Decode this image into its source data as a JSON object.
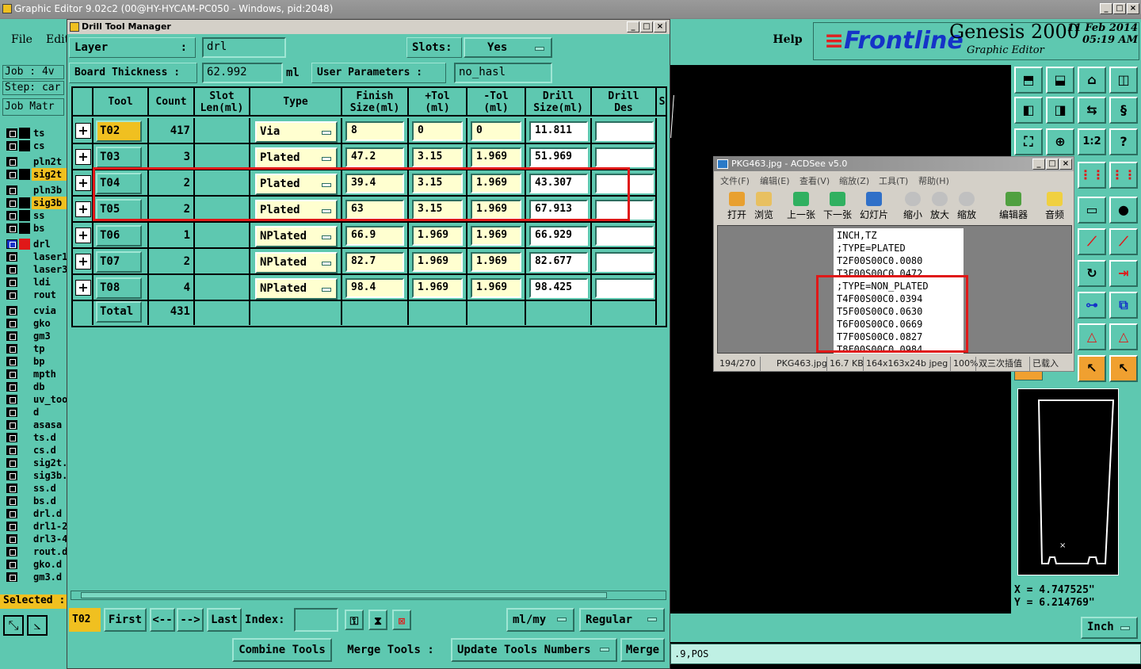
{
  "outer": {
    "title": "Graphic Editor 9.02c2 (00@HY-HYCAM-PC050 - Windows, pid:2048)"
  },
  "ge": {
    "menu": [
      "File",
      "Edit"
    ],
    "help": "Help",
    "logo_brand": "Frontline",
    "logo_product": "Genesis 2000",
    "logo_sub": "Graphic Editor",
    "date": "11 Feb 2014",
    "time": "05:19 AM",
    "job": "Job  : 4v",
    "step": "Step: car",
    "job_matrix": "Job Matr",
    "selected": "Selected :",
    "coords_x": "X  = 4.747525\"",
    "coords_y": "Y  = 6.214769\"",
    "units": "Inch",
    "cmdline": ".9,POS"
  },
  "layers": [
    {
      "name": "ts",
      "color": "#5ec8b0",
      "swatch": "#000000"
    },
    {
      "name": "cs",
      "color": "#5ec8b0",
      "swatch": "#000000"
    },
    {
      "name": "pln2t",
      "color": "#5ec8b0",
      "swatch": ""
    },
    {
      "name": "sig2t",
      "color": "#f0c020",
      "swatch": "#000000"
    },
    {
      "name": "pln3b",
      "color": "#5ec8b0",
      "swatch": ""
    },
    {
      "name": "sig3b",
      "color": "#f0c020",
      "swatch": "#000000"
    },
    {
      "name": "ss",
      "color": "#5ec8b0",
      "swatch": "#000000"
    },
    {
      "name": "bs",
      "color": "#5ec8b0",
      "swatch": "#000000"
    },
    {
      "name": "drl",
      "color": "#5ec8b0",
      "swatch": "#e01818"
    },
    {
      "name": "laser1",
      "color": "#5ec8b0",
      "swatch": ""
    },
    {
      "name": "laser3",
      "color": "#5ec8b0",
      "swatch": ""
    },
    {
      "name": "ldi",
      "color": "#5ec8b0",
      "swatch": ""
    },
    {
      "name": "rout",
      "color": "#5ec8b0",
      "swatch": ""
    },
    {
      "name": "cvia",
      "color": "#5ec8b0",
      "swatch": ""
    },
    {
      "name": "gko",
      "color": "#5ec8b0",
      "swatch": ""
    },
    {
      "name": "gm3",
      "color": "#5ec8b0",
      "swatch": ""
    },
    {
      "name": "tp",
      "color": "#5ec8b0",
      "swatch": ""
    },
    {
      "name": "bp",
      "color": "#5ec8b0",
      "swatch": ""
    },
    {
      "name": "mpth",
      "color": "#5ec8b0",
      "swatch": ""
    },
    {
      "name": "db",
      "color": "#5ec8b0",
      "swatch": ""
    },
    {
      "name": "uv_too",
      "color": "#5ec8b0",
      "swatch": ""
    },
    {
      "name": "d",
      "color": "#5ec8b0",
      "swatch": ""
    },
    {
      "name": "asasa",
      "color": "#5ec8b0",
      "swatch": ""
    },
    {
      "name": "ts.d",
      "color": "#5ec8b0",
      "swatch": ""
    },
    {
      "name": "cs.d",
      "color": "#5ec8b0",
      "swatch": ""
    },
    {
      "name": "sig2t.",
      "color": "#5ec8b0",
      "swatch": ""
    },
    {
      "name": "sig3b.",
      "color": "#5ec8b0",
      "swatch": ""
    },
    {
      "name": "ss.d",
      "color": "#5ec8b0",
      "swatch": ""
    },
    {
      "name": "bs.d",
      "color": "#5ec8b0",
      "swatch": ""
    },
    {
      "name": "drl.d",
      "color": "#5ec8b0",
      "swatch": ""
    },
    {
      "name": "drl1-2",
      "color": "#5ec8b0",
      "swatch": ""
    },
    {
      "name": "drl3-4",
      "color": "#5ec8b0",
      "swatch": ""
    },
    {
      "name": "rout.d",
      "color": "#5ec8b0",
      "swatch": ""
    },
    {
      "name": "gko.d",
      "color": "#5ec8b0",
      "swatch": ""
    },
    {
      "name": "gm3.d",
      "color": "#5ec8b0",
      "swatch": ""
    }
  ],
  "dtm": {
    "title": "Drill Tool Manager",
    "layer_label": "Layer",
    "layer_colon": ":",
    "layer_value": "drl",
    "slots_label": "Slots:",
    "slots_value": "Yes",
    "thickness_label": "Board Thickness :",
    "thickness_value": "62.992",
    "thickness_unit": "ml",
    "user_params_label": "User Parameters  :",
    "user_params_value": "no_hasl",
    "headers": [
      "Tool",
      "Count",
      "Slot\nLen(ml)",
      "Type",
      "Finish\nSize(ml)",
      "+Tol\n(ml)",
      "-Tol\n(ml)",
      "Drill\nSize(ml)",
      "Drill\nDes",
      "S"
    ],
    "rows": [
      {
        "tool": "T02",
        "count": "417",
        "type": "Via",
        "finish": "8",
        "ptol": "0",
        "mtol": "0",
        "drill": "11.811",
        "des": ""
      },
      {
        "tool": "T03",
        "count": "3",
        "type": "Plated",
        "finish": "47.2",
        "ptol": "3.15",
        "mtol": "1.969",
        "drill": "51.969",
        "des": ""
      },
      {
        "tool": "T04",
        "count": "2",
        "type": "Plated",
        "finish": "39.4",
        "ptol": "3.15",
        "mtol": "1.969",
        "drill": "43.307",
        "des": ""
      },
      {
        "tool": "T05",
        "count": "2",
        "type": "Plated",
        "finish": "63",
        "ptol": "3.15",
        "mtol": "1.969",
        "drill": "67.913",
        "des": ""
      },
      {
        "tool": "T06",
        "count": "1",
        "type": "NPlated",
        "finish": "66.9",
        "ptol": "1.969",
        "mtol": "1.969",
        "drill": "66.929",
        "des": ""
      },
      {
        "tool": "T07",
        "count": "2",
        "type": "NPlated",
        "finish": "82.7",
        "ptol": "1.969",
        "mtol": "1.969",
        "drill": "82.677",
        "des": ""
      },
      {
        "tool": "T08",
        "count": "4",
        "type": "NPlated",
        "finish": "98.4",
        "ptol": "1.969",
        "mtol": "1.969",
        "drill": "98.425",
        "des": ""
      }
    ],
    "total_label": "Total",
    "total_count": "431",
    "current_tool": "T02",
    "first": "First",
    "prev": "<--",
    "next": "-->",
    "last": "Last",
    "index_label": "Index:",
    "units_dd": "ml/my",
    "mode_dd": "Regular",
    "combine": "Combine Tools",
    "merge_label": "Merge Tools :",
    "update_dd": "Update Tools Numbers",
    "merge": "Merge"
  },
  "acdsee": {
    "title": "PKG463.jpg - ACDSee v5.0",
    "menu": [
      "文件(F)",
      "编辑(E)",
      "查看(V)",
      "缩放(Z)",
      "工具(T)",
      "帮助(H)"
    ],
    "toolbar": [
      "打开",
      "浏览",
      "上一张",
      "下一张",
      "幻灯片",
      "缩小",
      "放大",
      "缩放",
      "编辑器",
      "音频"
    ],
    "lines": [
      "INCH,TZ",
      ";TYPE=PLATED",
      "T2F00S00C0.0080",
      "T3F00S00C0.0472",
      ";TYPE=NON_PLATED",
      "T4F00S00C0.0394",
      "T5F00S00C0.0630",
      "T6F00S00C0.0669",
      "T7F00S00C0.0827",
      "T8F00S00C0.0984"
    ],
    "status": [
      "194/270",
      "PKG463.jpg",
      "16.7 KB",
      "164x163x24b jpeg",
      "100%",
      "双三次插值",
      "已载入"
    ]
  }
}
